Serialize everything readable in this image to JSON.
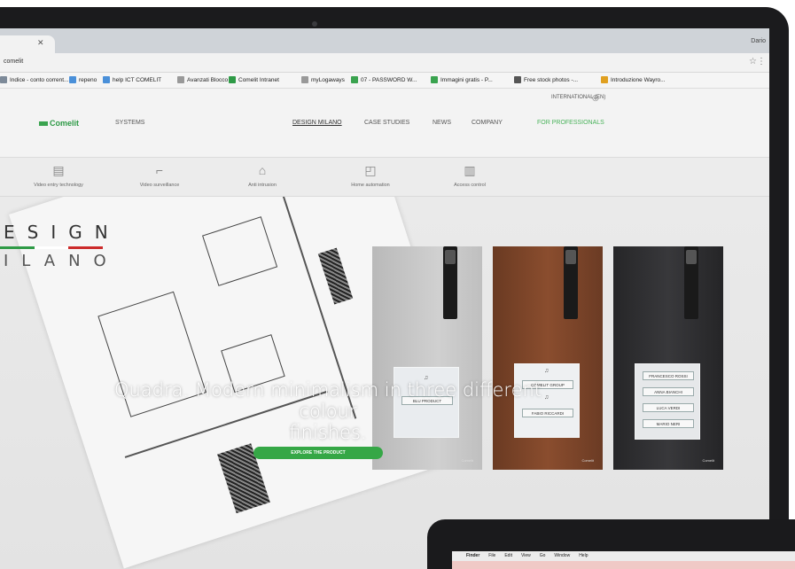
{
  "browser": {
    "user": "Dario",
    "url": "comelit",
    "bookmarks": [
      {
        "label": "Indice - conto corrent...",
        "color": "#7d8a99"
      },
      {
        "label": "repeno",
        "color": "#4a90d9"
      },
      {
        "label": "help ICT COMELIT",
        "color": "#4a90d9"
      },
      {
        "label": "Avanzati Blocco",
        "color": "#999999"
      },
      {
        "label": "Comelit Intranet",
        "color": "#2e9a46"
      },
      {
        "label": "myLogaways",
        "color": "#999999"
      },
      {
        "label": "07 - PASSWORD W...",
        "color": "#3aa34f"
      },
      {
        "label": "Immagini gratis - P...",
        "color": "#3aa34f"
      },
      {
        "label": "Free stock photos -...",
        "color": "#555555"
      },
      {
        "label": "Introduzione Wayro...",
        "color": "#e0a020"
      }
    ]
  },
  "site": {
    "international": "INTERNATIONAL (EN)",
    "logo": "Comelit",
    "nav": {
      "systems": "SYSTEMS",
      "design_milano": "DESIGN MILANO",
      "case_studies": "CASE STUDIES",
      "news": "NEWS",
      "company": "COMPANY",
      "for_professionals": "FOR PROFESSIONALS"
    },
    "subnav": [
      {
        "label": "Video entry technology",
        "icon": "intercom-icon",
        "glyph": "▤"
      },
      {
        "label": "Video surveillance",
        "icon": "camera-icon",
        "glyph": "⌐"
      },
      {
        "label": "Anti intrusion",
        "icon": "alarm-icon",
        "glyph": "⌂"
      },
      {
        "label": "Home automation",
        "icon": "home-automation-icon",
        "glyph": "◰"
      },
      {
        "label": "Access control",
        "icon": "access-control-icon",
        "glyph": "▥"
      }
    ]
  },
  "hero": {
    "design_title": "ESIGN",
    "milano_title": "ILANO",
    "flag_colors": [
      "#2e9a46",
      "#ffffff",
      "#cc2b2b"
    ],
    "headline_line1": "Quadra. Modern minimalism in three different colour",
    "headline_line2": "finishes.",
    "cta_label": "EXPLORE THE PRODUCT",
    "panels": {
      "grey": [
        "BLU PRODUCT"
      ],
      "wood": [
        "COMELIT GROUP",
        "FABIO RICCARDI"
      ],
      "black": [
        "FRANCESCO ROSSI",
        "ANNA BIANCHI",
        "LUCA VERDI",
        "MARIO NERI"
      ]
    },
    "slide_index": 3,
    "slide_count": 3
  },
  "mac2": {
    "menu": [
      "Finder",
      "File",
      "Edit",
      "View",
      "Go",
      "Window",
      "Help"
    ]
  }
}
